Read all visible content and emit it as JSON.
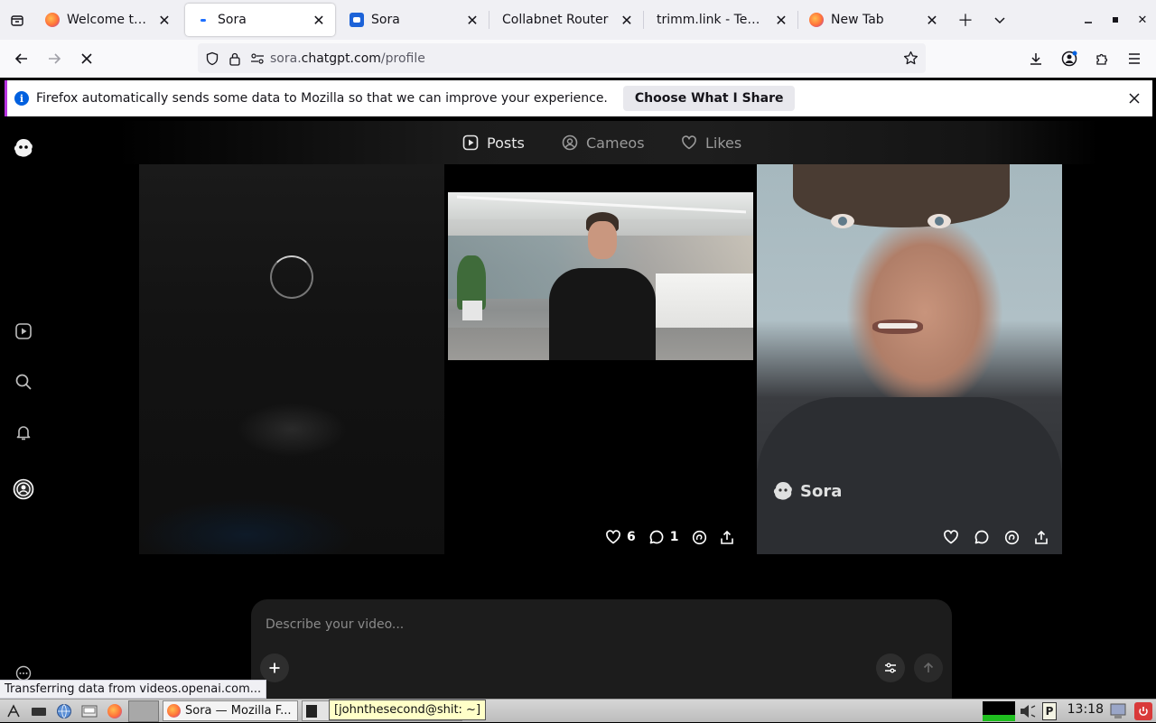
{
  "browser": {
    "tabs": [
      {
        "label": "Welcome to Firefox",
        "favicon": "firefox-icon",
        "active": false
      },
      {
        "label": "Sora",
        "favicon": "sora-icon",
        "active": true
      },
      {
        "label": "Sora",
        "favicon": "sora-blue-icon",
        "active": false
      },
      {
        "label": "Collabnet Router",
        "favicon": "",
        "active": false
      },
      {
        "label": "trimm.link - Tempora",
        "favicon": "",
        "active": false
      },
      {
        "label": "New Tab",
        "favicon": "firefox-icon",
        "active": false
      }
    ],
    "url_prefix": "sora.",
    "url_host": "chatgpt.com",
    "url_path": "/profile",
    "notification": {
      "text": "Firefox automatically sends some data to Mozilla so that we can improve your experience.",
      "button": "Choose What I Share",
      "info_glyph": "i"
    },
    "status_text": "Transferring data from videos.openai.com..."
  },
  "sora": {
    "nav_tabs": [
      {
        "label": "Posts",
        "icon": "play-square-icon",
        "active": true
      },
      {
        "label": "Cameos",
        "icon": "person-circle-icon",
        "active": false
      },
      {
        "label": "Likes",
        "icon": "heart-icon",
        "active": false
      }
    ],
    "posts": [
      {
        "state": "loading"
      },
      {
        "likes": "6",
        "comments": "1"
      },
      {
        "likes": "",
        "comments": "",
        "watermark": "Sora"
      }
    ],
    "composer": {
      "placeholder": "Describe your video..."
    }
  },
  "taskbar": {
    "task_firefox": "Sora — Mozilla F...",
    "task_terminal": "[johnthesecond@shit: ~]",
    "clock": "13:18"
  },
  "colors": {
    "accent_purple": "#b833e1",
    "info_blue": "#0060df",
    "page_bg": "#000000"
  }
}
